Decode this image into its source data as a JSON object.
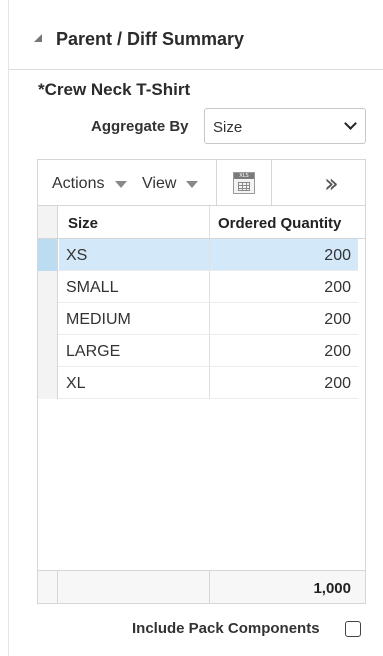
{
  "section": {
    "title": "Parent / Diff Summary"
  },
  "item": {
    "title": "*Crew Neck T-Shirt"
  },
  "aggregate": {
    "label": "Aggregate By",
    "selected": "Size"
  },
  "toolbar": {
    "actions_label": "Actions",
    "view_label": "View",
    "export_icon": "excel-export-icon",
    "more_icon": "double-chevron-right-icon"
  },
  "table": {
    "columns": [
      "Size",
      "Ordered Quantity"
    ],
    "rows": [
      {
        "size": "XS",
        "qty": "200",
        "selected": true
      },
      {
        "size": "SMALL",
        "qty": "200",
        "selected": false
      },
      {
        "size": "MEDIUM",
        "qty": "200",
        "selected": false
      },
      {
        "size": "LARGE",
        "qty": "200",
        "selected": false
      },
      {
        "size": "XL",
        "qty": "200",
        "selected": false
      }
    ],
    "total": "1,000"
  },
  "include_pack": {
    "label": "Include Pack Components",
    "checked": false
  },
  "colors": {
    "selected_row": "#d3e8f8",
    "border": "#d6d6d6"
  }
}
